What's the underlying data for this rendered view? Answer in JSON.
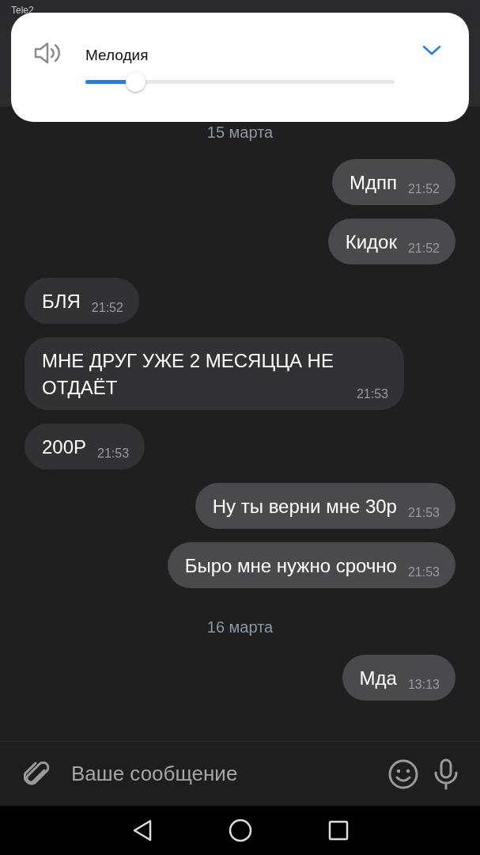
{
  "status_bar": {
    "carrier": "Tele2"
  },
  "volume_panel": {
    "label": "Мелодия",
    "level": 0.16
  },
  "messages": [
    {
      "kind": "date",
      "text": "15 марта"
    },
    {
      "kind": "message",
      "outgoing": true,
      "text": "Мдпп",
      "time": "21:52"
    },
    {
      "kind": "message",
      "outgoing": true,
      "text": "Кидок",
      "time": "21:52"
    },
    {
      "kind": "message",
      "outgoing": false,
      "text": "БЛЯ",
      "time": "21:52"
    },
    {
      "kind": "message",
      "outgoing": false,
      "text": "МНЕ ДРУГ УЖЕ 2 МЕСЯЦЦА НЕ ОТДАЁТ",
      "time": "21:53"
    },
    {
      "kind": "message",
      "outgoing": false,
      "text": "200Р",
      "time": "21:53"
    },
    {
      "kind": "message",
      "outgoing": true,
      "text": "Ну ты верни мне 30р",
      "time": "21:53"
    },
    {
      "kind": "message",
      "outgoing": true,
      "text": "Быро мне нужно срочно",
      "time": "21:53"
    },
    {
      "kind": "date",
      "text": "16 марта"
    },
    {
      "kind": "message",
      "outgoing": true,
      "text": "Мда",
      "time": "13:13"
    }
  ],
  "composer": {
    "placeholder": "Ваше сообщение"
  }
}
